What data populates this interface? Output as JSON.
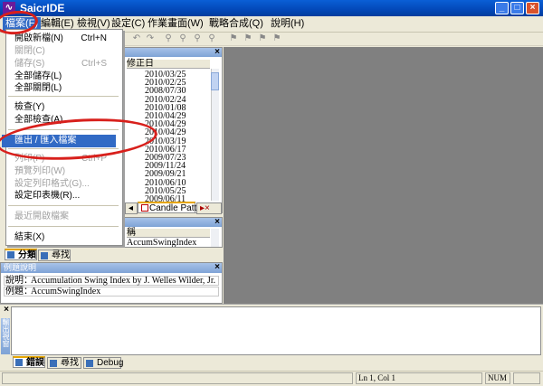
{
  "window": {
    "title": "SaicrIDE",
    "logo_glyph": "∿"
  },
  "menubar": {
    "items": [
      "檔案(F)",
      "編輯(E)",
      "檢視(V)",
      "設定(C)",
      "作業畫面(W)",
      "戰略合成(Q)",
      "說明(H)"
    ]
  },
  "file_menu": {
    "items": [
      {
        "label": "開啟新檔(N)",
        "shortcut": "Ctrl+N",
        "disabled": false
      },
      {
        "label": "關閉(C)",
        "shortcut": "",
        "disabled": true
      },
      {
        "label": "儲存(S)",
        "shortcut": "Ctrl+S",
        "disabled": true
      },
      {
        "label": "全部儲存(L)",
        "shortcut": "",
        "disabled": false
      },
      {
        "label": "全部關閉(L)",
        "shortcut": "",
        "disabled": false
      },
      {
        "label": "檢查(Y)",
        "shortcut": "",
        "disabled": false
      },
      {
        "label": "全部檢查(A)",
        "shortcut": "",
        "disabled": false
      },
      {
        "label": "匯出 / 匯入檔案",
        "shortcut": "",
        "disabled": false
      },
      {
        "label": "列印(P)",
        "shortcut": "Ctrl+P",
        "disabled": true
      },
      {
        "label": "預覽列印(W)",
        "shortcut": "",
        "disabled": true
      },
      {
        "label": "設定列印格式(G)...",
        "shortcut": "",
        "disabled": true
      },
      {
        "label": "設定印表機(R)...",
        "shortcut": "",
        "disabled": false
      },
      {
        "label": "最近開啟檔案",
        "shortcut": "",
        "disabled": true
      },
      {
        "label": "結束(X)",
        "shortcut": "",
        "disabled": false
      }
    ]
  },
  "file_list": {
    "header": "修正日",
    "dates": [
      "2010/03/25",
      "2010/02/25",
      "2008/07/30",
      "2010/02/24",
      "2010/01/08",
      "2010/04/29",
      "2010/04/29",
      "2010/04/29",
      "2010/03/19",
      "2010/06/17",
      "2009/07/23",
      "2009/11/24",
      "2009/09/21",
      "2010/06/10",
      "2010/05/25",
      "2009/06/11"
    ],
    "tab_label": "Candle Pattern"
  },
  "search_panel": {
    "header": "稱",
    "row": "AccumSwingIndex",
    "tabs": [
      "分類",
      "尋找"
    ]
  },
  "example_panel": {
    "title": "例題說明",
    "desc_label": "說明：",
    "desc_value": "Accumulation Swing Index by J. Welles Wilder, Jr.",
    "example_label": "例題：",
    "example_value": "AccumSwingIndex"
  },
  "output_panel": {
    "tabs": [
      "錯誤",
      "尋找",
      "Debug"
    ],
    "side_label": "輸出視窗"
  },
  "statusbar": {
    "position": "Ln 1, Col 1",
    "num": "NUM"
  },
  "colors": {
    "highlight": "#316ac5",
    "annotation": "#d8201c",
    "titlebar": "#0348b8"
  }
}
